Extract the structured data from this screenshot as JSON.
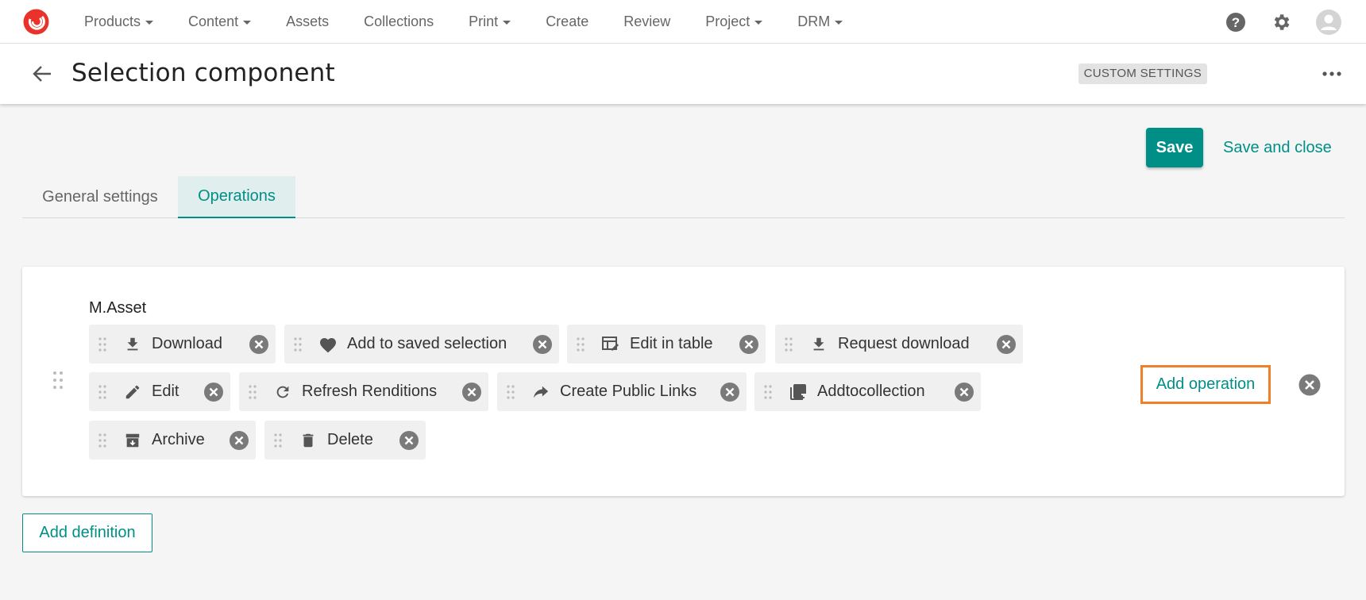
{
  "nav": {
    "items": [
      {
        "label": "Products",
        "dropdown": true
      },
      {
        "label": "Content",
        "dropdown": true
      },
      {
        "label": "Assets",
        "dropdown": false
      },
      {
        "label": "Collections",
        "dropdown": false
      },
      {
        "label": "Print",
        "dropdown": true
      },
      {
        "label": "Create",
        "dropdown": false
      },
      {
        "label": "Review",
        "dropdown": false
      },
      {
        "label": "Project",
        "dropdown": true
      },
      {
        "label": "DRM",
        "dropdown": true
      }
    ],
    "icons": [
      "help-icon",
      "gear-icon",
      "user-avatar-icon"
    ]
  },
  "header": {
    "title": "Selection component",
    "badge": "CUSTOM SETTINGS"
  },
  "actions": {
    "save": "Save",
    "save_and_close": "Save and close"
  },
  "tabs": {
    "general": "General settings",
    "operations": "Operations",
    "active": "operations"
  },
  "definition": {
    "title": "M.Asset",
    "operations": [
      {
        "label": "Download",
        "icon": "download-icon"
      },
      {
        "label": "Add to saved selection",
        "icon": "heart-icon"
      },
      {
        "label": "Edit in table",
        "icon": "table-edit-icon"
      },
      {
        "label": "Request download",
        "icon": "download-icon"
      },
      {
        "label": "Edit",
        "icon": "pencil-icon"
      },
      {
        "label": "Refresh Renditions",
        "icon": "refresh-icon"
      },
      {
        "label": "Create Public Links",
        "icon": "share-arrow-icon"
      },
      {
        "label": "Addtocollection",
        "icon": "add-to-collection-icon"
      },
      {
        "label": "Archive",
        "icon": "archive-icon"
      },
      {
        "label": "Delete",
        "icon": "trash-icon"
      }
    ],
    "add_operation": "Add operation"
  },
  "add_definition": "Add definition",
  "colors": {
    "accent": "#008f87",
    "highlight_border": "#f07f2a",
    "logo": "#e8322a",
    "chip_bg": "#f0f0f0"
  }
}
